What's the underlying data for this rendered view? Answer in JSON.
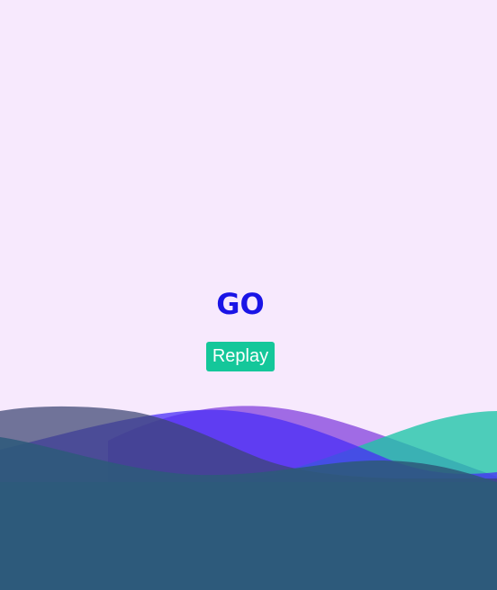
{
  "status": {
    "text": "GO"
  },
  "controls": {
    "replay_label": "Replay"
  },
  "colors": {
    "background": "#f7e9fd",
    "status_text": "#1a14e6",
    "button": "#14c79a",
    "wave_base": "#2d5a7b",
    "wave_slate": "#3b4572",
    "wave_blue": "#4a2ef5",
    "wave_violet": "#8848de",
    "wave_teal": "#1ec5a6"
  }
}
